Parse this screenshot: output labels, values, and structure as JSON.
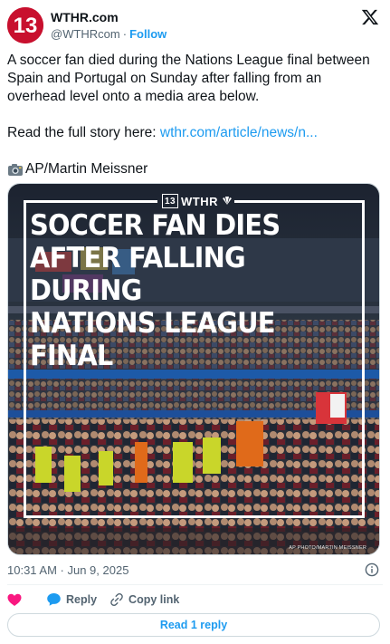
{
  "account": {
    "avatar_text": "13",
    "name": "WTHR.com",
    "handle": "@WTHRcom",
    "separator": "·",
    "follow_label": "Follow",
    "platform_icon": "x-logo-icon"
  },
  "tweet": {
    "text": "A soccer fan died during the Nations League final between Spain and Portugal on Sunday after falling from an overhead level onto a media area below.",
    "link_prefix": "Read the full story here: ",
    "link_text": "wthr.com/article/news/n...",
    "credit": "AP/Martin Meissner",
    "credit_icon": "camera-icon"
  },
  "media": {
    "brand": "WTHR",
    "brand_box": "13",
    "headline_lines": [
      "SOCCER FAN DIES",
      "AFTER FALLING DURING",
      "NATIONS LEAGUE FINAL"
    ],
    "photo_credit": "AP PHOTO/MARTIN MEISSNER"
  },
  "meta": {
    "timestamp": "10:31 AM · Jun 9, 2025"
  },
  "actions": {
    "like_label": "",
    "reply_label": "Reply",
    "copy_label": "Copy link"
  },
  "replies": {
    "label": "Read 1 reply"
  },
  "colors": {
    "accent": "#1d9bf0",
    "like": "#f91880",
    "brand_red": "#c8102e"
  }
}
